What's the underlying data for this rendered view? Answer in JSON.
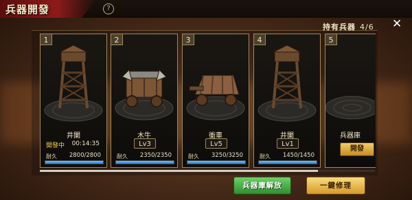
{
  "header": {
    "title": "兵器開發",
    "help_icon": "?"
  },
  "inventory": {
    "label": "持有兵器",
    "count": "4/6"
  },
  "close_icon": "✕",
  "cards": [
    {
      "num": "1",
      "name": "井闌",
      "status": "開發中",
      "timer": "00:14:35",
      "durability_label": "耐久",
      "durability": "2800/2800",
      "durability_fraction": 1.0
    },
    {
      "num": "2",
      "name": "木牛",
      "level": "Lv3",
      "durability_label": "耐久",
      "durability": "2350/2350",
      "durability_fraction": 1.0
    },
    {
      "num": "3",
      "name": "衝車",
      "level": "Lv5",
      "durability_label": "耐久",
      "durability": "3250/3250",
      "durability_fraction": 1.0
    },
    {
      "num": "4",
      "name": "井闌",
      "level": "Lv1",
      "durability_label": "耐久",
      "durability": "1450/1450",
      "durability_fraction": 1.0
    },
    {
      "num": "5",
      "name": "兵器庫",
      "develop_label": "開發"
    }
  ],
  "buttons": {
    "unlock": "兵器庫解放",
    "repair_all": "一鍵修理"
  },
  "colors": {
    "accent_gold": "#d79a2a",
    "accent_green": "#2f8f2c",
    "durability_blue": "#2f7ecb",
    "status_yellow": "#f5d14a"
  }
}
